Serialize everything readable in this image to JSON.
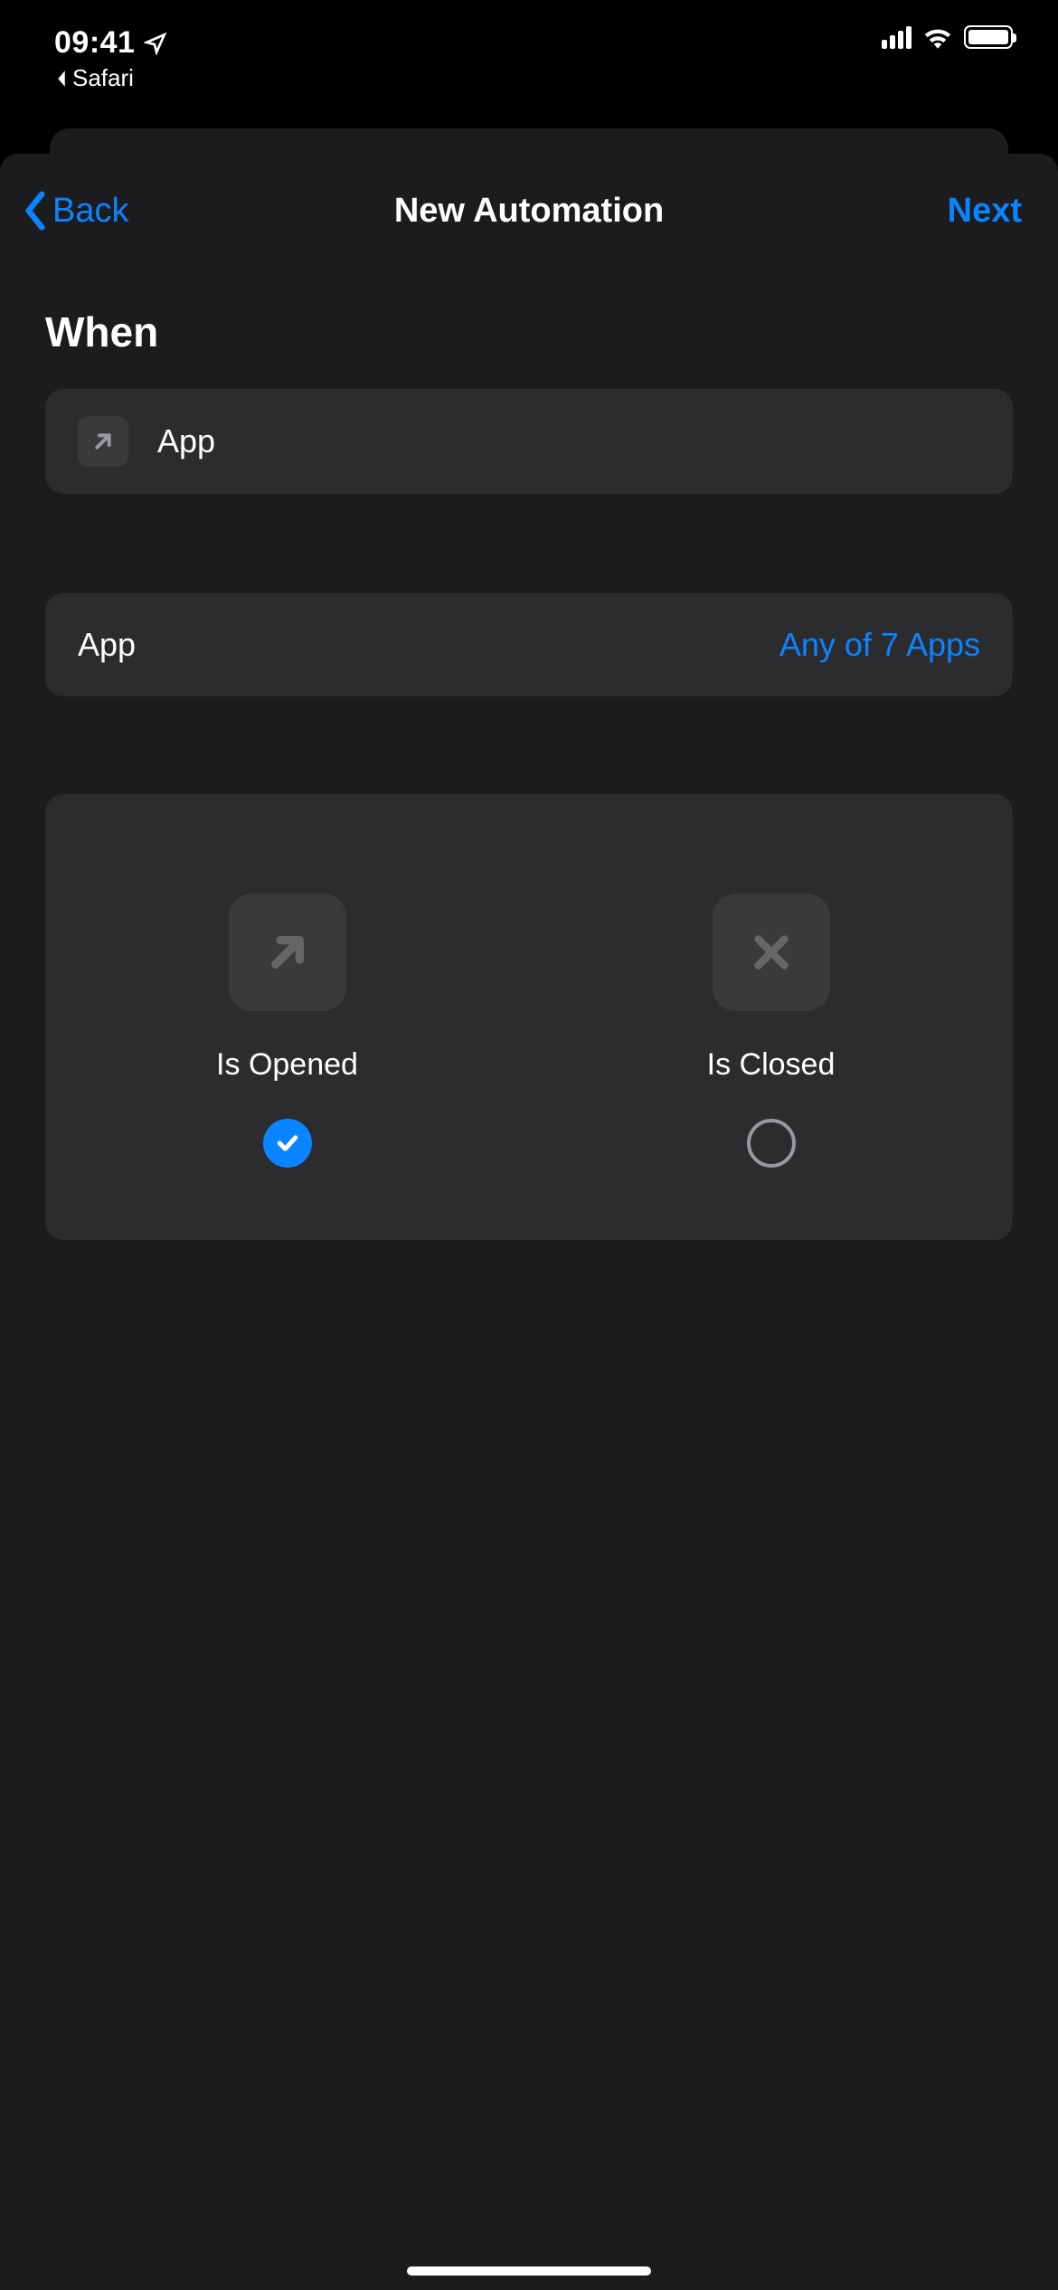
{
  "status_bar": {
    "time": "09:41",
    "back_app": "Safari"
  },
  "nav": {
    "back_label": "Back",
    "title": "New Automation",
    "next_label": "Next"
  },
  "section": {
    "header": "When"
  },
  "trigger_cell": {
    "label": "App"
  },
  "app_cell": {
    "label": "App",
    "value": "Any of 7 Apps"
  },
  "options": {
    "opened": {
      "label": "Is Opened",
      "selected": true
    },
    "closed": {
      "label": "Is Closed",
      "selected": false
    }
  }
}
